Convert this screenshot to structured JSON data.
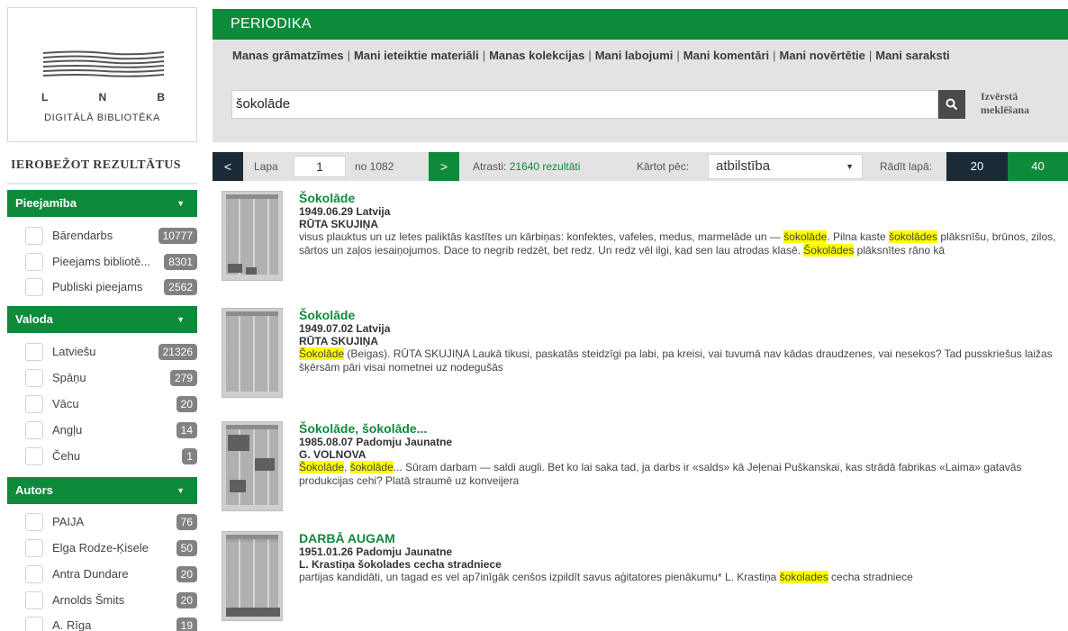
{
  "logo": {
    "letters": [
      "L",
      "N",
      "B"
    ],
    "subtitle": "DIGITĀLĀ BIBLIOTĒKA"
  },
  "header": {
    "title": "PERIODIKA",
    "user_links": [
      "Manas grāmatzīmes",
      "Mani ieteiktie materiāli",
      "Manas kolekcijas",
      "Mani labojumi",
      "Mani komentāri",
      "Mani novērtētie",
      "Mani saraksti"
    ],
    "separator": "|"
  },
  "search": {
    "value": "šokolāde",
    "button_icon": "search-icon",
    "advanced_line1": "Izvērstā",
    "advanced_line2": "meklēšana"
  },
  "sidebar": {
    "title": "IEROBEŽOT REZULTĀTUS",
    "facets": [
      {
        "label": "Pieejamība",
        "items": [
          {
            "label": "Bārendarbs",
            "count": "10777"
          },
          {
            "label": "Pieejams bibliotē...",
            "count": "8301"
          },
          {
            "label": "Publiski pieejams",
            "count": "2562"
          }
        ]
      },
      {
        "label": "Valoda",
        "items": [
          {
            "label": "Latviešu",
            "count": "21326"
          },
          {
            "label": "Spāņu",
            "count": "279"
          },
          {
            "label": "Vācu",
            "count": "20"
          },
          {
            "label": "Angļu",
            "count": "14"
          },
          {
            "label": "Čehu",
            "count": "1"
          }
        ]
      },
      {
        "label": "Autors",
        "items": [
          {
            "label": "PAIJA",
            "count": "76"
          },
          {
            "label": "Elga Rodze-Ķisele",
            "count": "50"
          },
          {
            "label": "Antra Dundare",
            "count": "20"
          },
          {
            "label": "Arnolds Šmits",
            "count": "20"
          },
          {
            "label": "A. Rīga",
            "count": "19"
          }
        ]
      }
    ]
  },
  "pager": {
    "prev": "<",
    "page_label": "Lapa",
    "page": "1",
    "of_pages": "no 1082",
    "next": ">",
    "found_label": "Atrasti:",
    "found_value": "21640 rezultāti",
    "sort_label": "Kārtot pēc:",
    "sort_value": "atbilstība",
    "per_page_label": "Rādīt lapā:",
    "per_page_options": [
      "20",
      "40"
    ]
  },
  "results": [
    {
      "title": "Šokolāde",
      "date_source": "1949.06.29 Latvija",
      "author": "RŪTA SKUJIŅA",
      "snippet": [
        {
          "t": "visus plauktus un uz letes paliktās kastītes un kārbiņas: konfektes, vafeles, medus, marmelāde un — "
        },
        {
          "t": "šokolāde",
          "hl": true
        },
        {
          "t": ". Pilna kaste "
        },
        {
          "t": "šokolādes",
          "hl": true
        },
        {
          "t": " plāksnīšu, brūnos, zilos, sārtos un zaļos iesaiņojumos. Dace to negrib redzēt, bet redz. Un redz vēl ilgi, kad sen lau atrodas klasē. "
        },
        {
          "t": "Šokolādes",
          "hl": true
        },
        {
          "t": " plāksnītes rāno kā"
        }
      ]
    },
    {
      "title": "Šokolāde",
      "date_source": "1949.07.02 Latvija",
      "author": "RŪTA SKUJIŅA",
      "snippet": [
        {
          "t": "Šokolāde",
          "hl": true
        },
        {
          "t": " (Beigas). RŪTA SKUJIŅA Laukā tikusi, paskatās steidzīgi pa labi, pa kreisi, vai tuvumā nav kādas draudzenes, vai nesekos? Tad pusskriešus laižas šķērsām pāri visai nometnei uz nodegušās"
        }
      ]
    },
    {
      "title": "Šokolāde, šokolāde...",
      "date_source": "1985.08.07 Padomju Jaunatne",
      "author": "G. VOLNOVA",
      "snippet": [
        {
          "t": "Šokolāde",
          "hl": true
        },
        {
          "t": ", "
        },
        {
          "t": "šokolāde",
          "hl": true
        },
        {
          "t": "... Sūram darbam — saldi augli. Bet ko lai saka tad, ja darbs ir «salds» kā Jeļenai Puškanskai, kas strādā fabrikas «Laima» gatavās produkcijas cehi? Platā straumē uz konveijera"
        }
      ]
    },
    {
      "title": "DARBĀ AUGAM",
      "date_source": "1951.01.26 Padomju Jaunatne",
      "author": "L. Krastiņa šokolades cecha stradniece",
      "snippet": [
        {
          "t": "partijas kandidāti, un tagad es vel ap7inīgāk cenšos izpildīt savus aģitatores pienākumu* L. Krastiņa "
        },
        {
          "t": "šokolades",
          "hl": true
        },
        {
          "t": " cecha stradniece"
        }
      ]
    }
  ]
}
